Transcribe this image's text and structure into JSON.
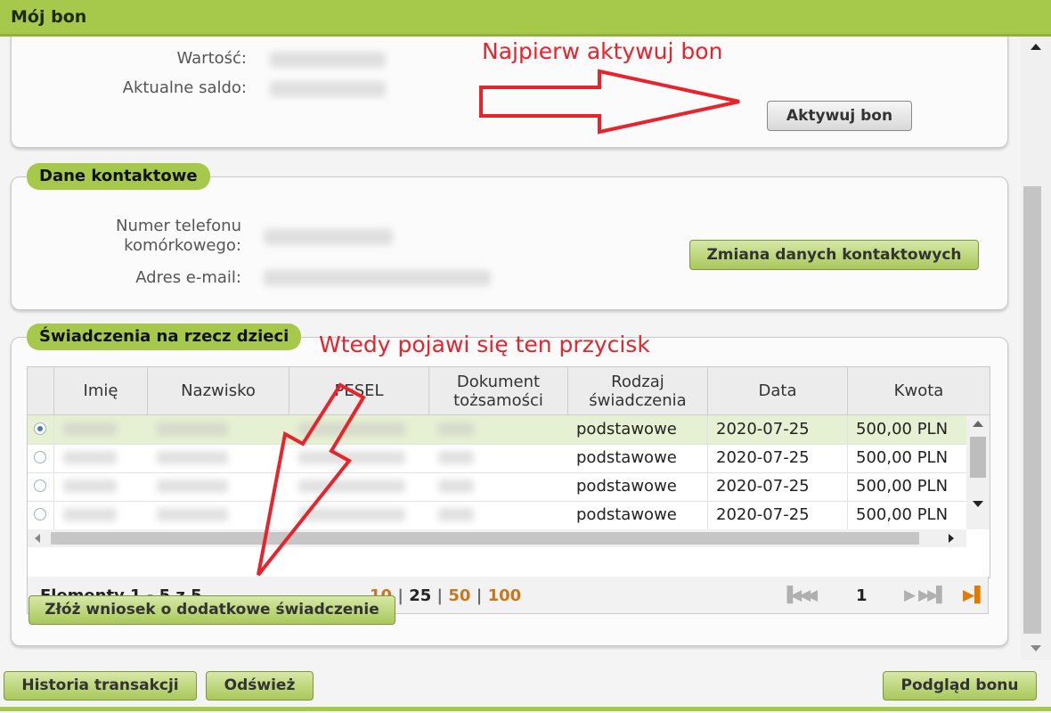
{
  "window": {
    "title": "Mój bon"
  },
  "voucher": {
    "value_label": "Wartość:",
    "balance_label": "Aktualne saldo:",
    "activate_button": "Aktywuj bon"
  },
  "contact": {
    "title": "Dane kontaktowe",
    "phone_label": "Numer telefonu\nkomórkowego:",
    "email_label": "Adres e-mail:",
    "change_button": "Zmiana danych kontaktowych"
  },
  "benefits": {
    "title": "Świadczenia na rzecz dzieci",
    "columns": [
      "Imię",
      "Nazwisko",
      "PESEL",
      "Dokument\ntożsamości",
      "Rodzaj\nświadczenia",
      "Data",
      "Kwota"
    ],
    "rows": [
      {
        "type": "podstawowe",
        "date": "2020-07-25",
        "amount": "500,00 PLN",
        "selected": true
      },
      {
        "type": "podstawowe",
        "date": "2020-07-25",
        "amount": "500,00 PLN",
        "selected": false
      },
      {
        "type": "podstawowe",
        "date": "2020-07-25",
        "amount": "500,00 PLN",
        "selected": false
      },
      {
        "type": "podstawowe",
        "date": "2020-07-25",
        "amount": "500,00 PLN",
        "selected": false
      }
    ],
    "pager": {
      "items_text": "Elementy 1 - 5 z 5",
      "sizes": [
        "10",
        "25",
        "50",
        "100"
      ],
      "current_size": "25",
      "page": "1"
    },
    "apply_button": "Złóż wniosek o dodatkowe świadczenie"
  },
  "annotations": {
    "first": "Najpierw aktywuj bon",
    "second": "Wtedy pojawi się ten przycisk",
    "color": "#e8232b"
  },
  "footer": {
    "history_button": "Historia transakcji",
    "refresh_button": "Odśwież",
    "preview_button": "Podgląd bonu"
  },
  "colors": {
    "accent": "#a6c84b",
    "selected_row": "#e6f0d2",
    "pager_active": "#c8781a"
  }
}
